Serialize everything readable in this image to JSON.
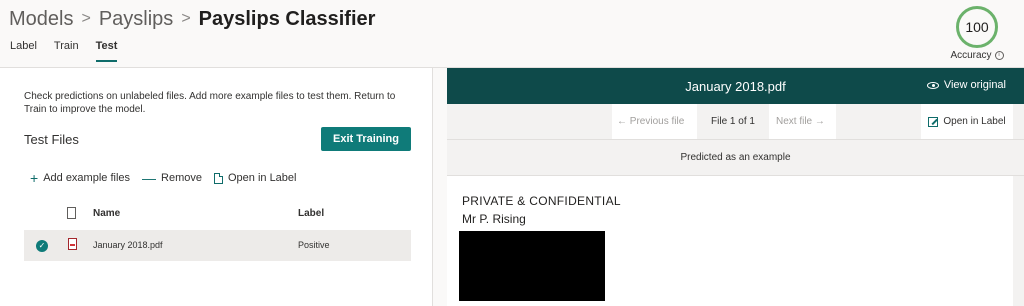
{
  "breadcrumb": {
    "items": [
      "Models",
      "Payslips"
    ],
    "current": "Payslips Classifier",
    "separator": ">"
  },
  "tabs": [
    {
      "label": "Label"
    },
    {
      "label": "Train"
    },
    {
      "label": "Test",
      "active": true
    }
  ],
  "accuracy": {
    "value": "100",
    "label": "Accuracy"
  },
  "left": {
    "description": "Check predictions on unlabeled files. Add more example files to test them. Return to Train to improve the model.",
    "title": "Test Files",
    "exit_button": "Exit Training",
    "commands": {
      "add": "Add example files",
      "remove": "Remove",
      "open": "Open in Label"
    },
    "table": {
      "columns": {
        "name": "Name",
        "label": "Label"
      },
      "rows": [
        {
          "name": "January 2018.pdf",
          "label": "Positive",
          "selected": true
        }
      ]
    }
  },
  "viewer": {
    "title": "January 2018.pdf",
    "view_original": "View original",
    "prev": "Previous file",
    "position": "File 1 of 1",
    "next": "Next file",
    "open_in_label": "Open in Label",
    "prediction": "Predicted as an example",
    "lines": [
      "PRIVATE & CONFIDENTIAL",
      "Mr P. Rising"
    ]
  },
  "colors": {
    "accent": "#0f7b79",
    "viewer_bar": "#0e4a4a",
    "accuracy_ring": "#6bb26b"
  }
}
